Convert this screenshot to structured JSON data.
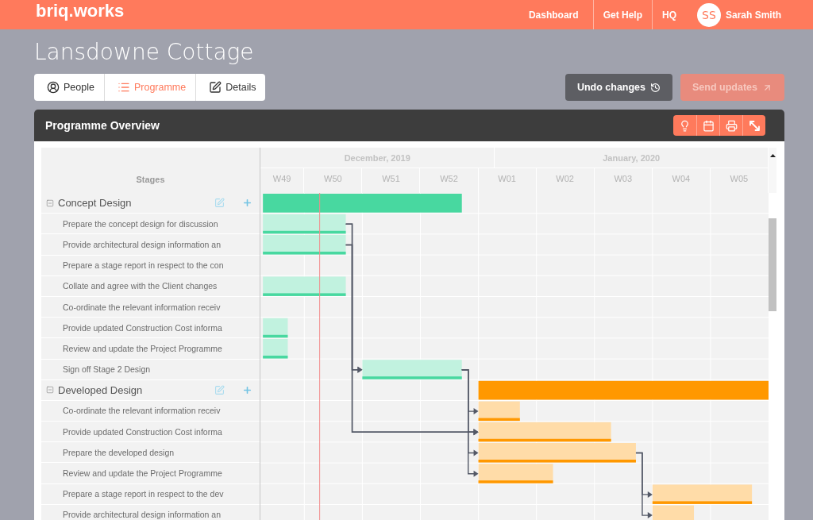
{
  "header": {
    "logo": "briq.works",
    "nav": [
      "Dashboard",
      "Get Help",
      "HQ"
    ],
    "user": {
      "initials": "SS",
      "name": "Sarah Smith"
    }
  },
  "project": {
    "title": "Lansdowne Cottage"
  },
  "tabs": [
    {
      "label": "People",
      "selected": false
    },
    {
      "label": "Programme",
      "selected": true
    },
    {
      "label": "Details",
      "selected": false
    }
  ],
  "actions": [
    {
      "label": "Undo changes",
      "kind": "secondary",
      "disabled": false
    },
    {
      "label": "Send updates",
      "kind": "primary",
      "disabled": true
    }
  ],
  "panel": {
    "title": "Programme Overview"
  },
  "gantt": {
    "stages_heading": "Stages",
    "months": [
      "December, 2019",
      "January, 2020"
    ],
    "weeks": [
      "W49",
      "W50",
      "W51",
      "W52",
      "W01",
      "W02",
      "W03",
      "W04",
      "W05"
    ],
    "stages": [
      {
        "name": "Concept Design",
        "expanded": true,
        "color": "#48d8a0",
        "tasks": [
          {
            "name": "Prepare the concept design for discussion"
          },
          {
            "name": "Provide architectural design information an"
          },
          {
            "name": "Prepare a stage report in respect to the con"
          },
          {
            "name": "Collate and agree with the Client changes"
          },
          {
            "name": "Co-ordinate the relevant information receiv"
          },
          {
            "name": "Provide updated Construction Cost informa"
          },
          {
            "name": "Review and update the Project Programme"
          },
          {
            "name": "Sign off Stage 2 Design"
          }
        ]
      },
      {
        "name": "Developed Design",
        "expanded": true,
        "color": "#ff9800",
        "tasks": [
          {
            "name": "Co-ordinate the relevant information receiv"
          },
          {
            "name": "Provide updated Construction Cost informa"
          },
          {
            "name": "Prepare the developed design"
          },
          {
            "name": "Review and update the Project Programme"
          },
          {
            "name": "Prepare a stage report in respect to the dev"
          },
          {
            "name": "Provide architectural design information an"
          }
        ]
      }
    ]
  }
}
